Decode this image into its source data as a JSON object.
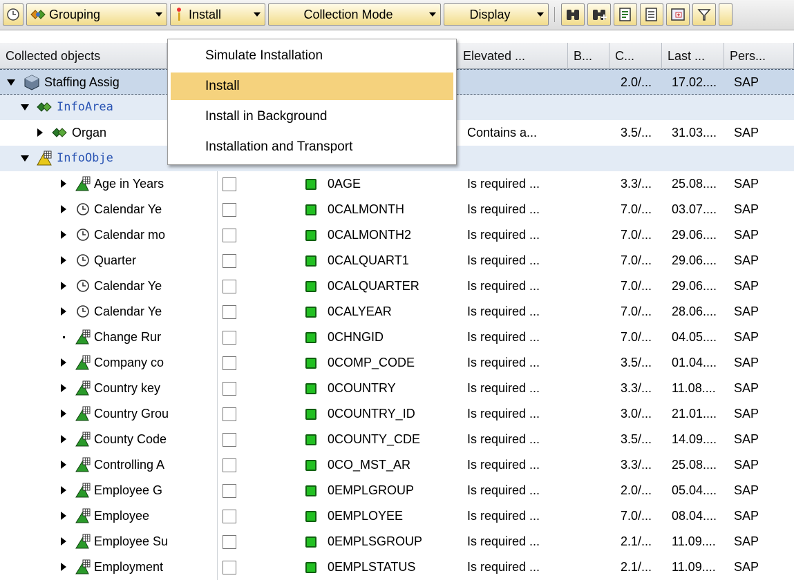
{
  "toolbar": {
    "grouping_label": "Grouping",
    "install_label": "Install",
    "collection_mode_label": "Collection Mode",
    "display_label": "Display",
    "icons": [
      "clock-icon",
      "grouping-icon",
      "install-icon",
      "binoculars-find-icon",
      "binoculars-find-next-icon",
      "export-icon",
      "print-icon",
      "layout-icon",
      "filter-icon"
    ]
  },
  "columns": [
    "Collected objects",
    "Elevated ...",
    "B...",
    "C...",
    "Last ...",
    "Pers..."
  ],
  "install_menu": {
    "items": [
      {
        "label": "Simulate Installation",
        "active": false
      },
      {
        "label": "Install",
        "active": true
      },
      {
        "label": "Install in Background",
        "active": false
      },
      {
        "label": "Installation and Transport",
        "active": false
      }
    ]
  },
  "groups": {
    "root": {
      "label": "Staffing Assig",
      "version": "2.0/...",
      "last": "17.02....",
      "person": "SAP"
    },
    "infoareas": {
      "label": "InfoArea"
    },
    "organ": {
      "label": "Organ",
      "elevated": "Contains a...",
      "version": "3.5/...",
      "last": "31.03....",
      "person": "SAP"
    },
    "infoobjects": {
      "label": "InfoObje"
    }
  },
  "rows": [
    {
      "label": "Age in Years",
      "icon": "characteristic-icon",
      "tech": "0AGE",
      "elevated": "Is required ...",
      "version": "3.3/...",
      "last": "25.08....",
      "person": "SAP"
    },
    {
      "label": "Calendar Ye",
      "icon": "time-characteristic-icon",
      "tech": "0CALMONTH",
      "elevated": "Is required ...",
      "version": "7.0/...",
      "last": "03.07....",
      "person": "SAP"
    },
    {
      "label": "Calendar mo",
      "icon": "time-characteristic-icon",
      "tech": "0CALMONTH2",
      "elevated": "Is required ...",
      "version": "7.0/...",
      "last": "29.06....",
      "person": "SAP"
    },
    {
      "label": "Quarter",
      "icon": "time-characteristic-icon",
      "tech": "0CALQUART1",
      "elevated": "Is required ...",
      "version": "7.0/...",
      "last": "29.06....",
      "person": "SAP"
    },
    {
      "label": "Calendar Ye",
      "icon": "time-characteristic-icon",
      "tech": "0CALQUARTER",
      "elevated": "Is required ...",
      "version": "7.0/...",
      "last": "29.06....",
      "person": "SAP"
    },
    {
      "label": "Calendar Ye",
      "icon": "time-characteristic-icon",
      "tech": "0CALYEAR",
      "elevated": "Is required ...",
      "version": "7.0/...",
      "last": "28.06....",
      "person": "SAP"
    },
    {
      "label": "Change Rur",
      "icon": "characteristic-icon",
      "tech": "0CHNGID",
      "elevated": "Is required ...",
      "version": "7.0/...",
      "last": "04.05....",
      "person": "SAP"
    },
    {
      "label": "Company co",
      "icon": "characteristic-icon",
      "tech": "0COMP_CODE",
      "elevated": "Is required ...",
      "version": "3.5/...",
      "last": "01.04....",
      "person": "SAP"
    },
    {
      "label": "Country key",
      "icon": "characteristic-icon",
      "tech": "0COUNTRY",
      "elevated": "Is required ...",
      "version": "3.3/...",
      "last": "11.08....",
      "person": "SAP"
    },
    {
      "label": "Country Grou",
      "icon": "characteristic-icon",
      "tech": "0COUNTRY_ID",
      "elevated": "Is required ...",
      "version": "3.0/...",
      "last": "21.01....",
      "person": "SAP"
    },
    {
      "label": "County Code",
      "icon": "characteristic-icon",
      "tech": "0COUNTY_CDE",
      "elevated": "Is required ...",
      "version": "3.5/...",
      "last": "14.09....",
      "person": "SAP"
    },
    {
      "label": "Controlling A",
      "icon": "characteristic-icon",
      "tech": "0CO_MST_AR",
      "elevated": "Is required ...",
      "version": "3.3/...",
      "last": "25.08....",
      "person": "SAP"
    },
    {
      "label": "Employee G",
      "icon": "characteristic-icon",
      "tech": "0EMPLGROUP",
      "elevated": "Is required ...",
      "version": "2.0/...",
      "last": "05.04....",
      "person": "SAP"
    },
    {
      "label": "Employee",
      "icon": "characteristic-icon",
      "tech": "0EMPLOYEE",
      "elevated": "Is required ...",
      "version": "7.0/...",
      "last": "08.04....",
      "person": "SAP"
    },
    {
      "label": "Employee Su",
      "icon": "characteristic-icon",
      "tech": "0EMPLSGROUP",
      "elevated": "Is required ...",
      "version": "2.1/...",
      "last": "11.09....",
      "person": "SAP"
    },
    {
      "label": "Employment",
      "icon": "characteristic-icon",
      "tech": "0EMPLSTATUS",
      "elevated": "Is required ...",
      "version": "2.1/...",
      "last": "11.09....",
      "person": "SAP"
    }
  ],
  "colors": {
    "accent_button": "#f2dd8c",
    "menu_highlight": "#f5d27d",
    "status_green": "#22c022",
    "group_row": "#e3ebf5",
    "link_blue": "#2b55b4"
  }
}
